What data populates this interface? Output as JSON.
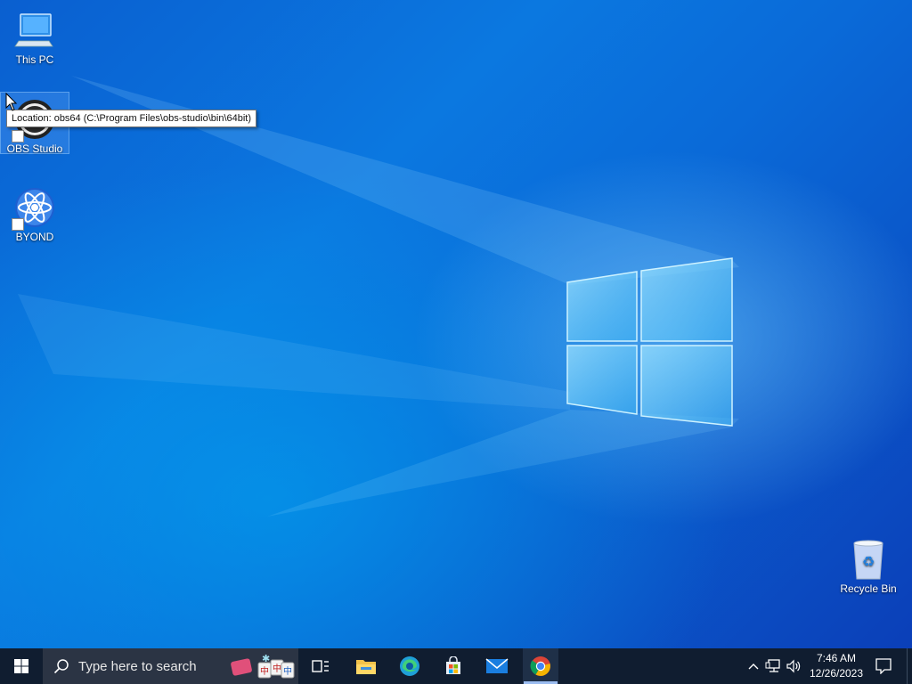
{
  "desktop": {
    "icons": [
      {
        "label": "This PC",
        "icon": "computer-icon"
      },
      {
        "label": "OBS Studio",
        "icon": "obs-icon"
      },
      {
        "label": "BYOND",
        "icon": "byond-icon"
      },
      {
        "label": "Recycle Bin",
        "icon": "recycle-bin-icon"
      }
    ],
    "tooltip": "Location: obs64 (C:\\Program Files\\obs-studio\\bin\\64bit)"
  },
  "taskbar": {
    "search_placeholder": "Type here to search",
    "apps": [
      "task-view-icon",
      "file-explorer-icon",
      "edge-icon",
      "store-icon",
      "mail-icon",
      "chrome-icon"
    ],
    "active_app": "chrome-icon",
    "clock": {
      "time": "7:46 AM",
      "date": "12/26/2023"
    },
    "tray_icons": [
      "chevron-up-icon",
      "network-icon",
      "volume-icon",
      "notification-icon"
    ]
  },
  "colors": {
    "taskbar": "#101d30",
    "desktop_accent": "#0b78e0"
  }
}
